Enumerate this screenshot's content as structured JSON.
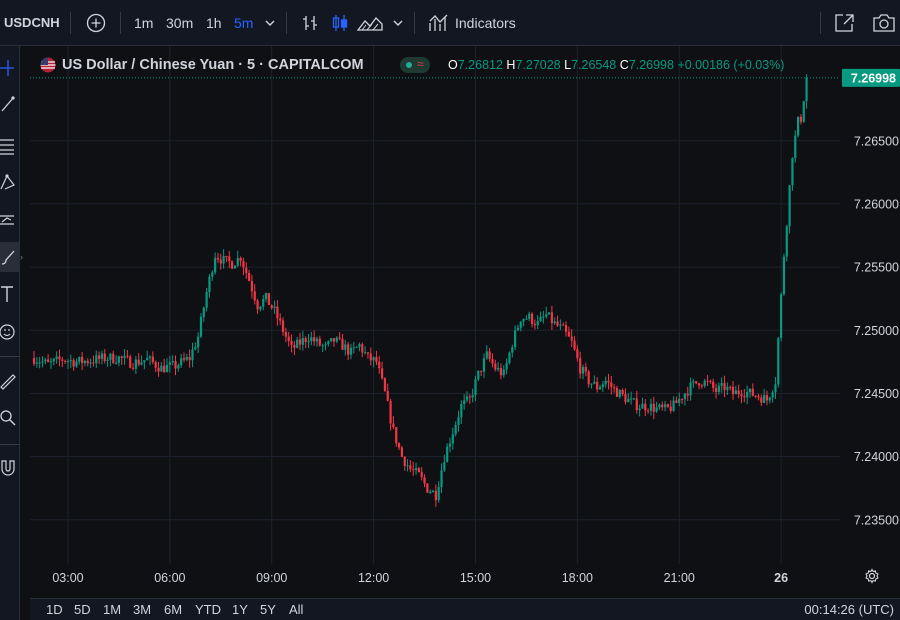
{
  "toolbar": {
    "symbol": "USDCNH",
    "intervals": [
      "1m",
      "30m",
      "1h",
      "5m"
    ],
    "active_interval": "5m",
    "indicators_label": "Indicators"
  },
  "legend": {
    "title": "US Dollar / Chinese Yuan · 5 · CAPITALCOM",
    "o_label": "O",
    "o": "7.26812",
    "h_label": "H",
    "h": "7.27028",
    "l_label": "L",
    "l": "7.26548",
    "c_label": "C",
    "c": "7.26998",
    "change": "+0.00186 (+0.03%)"
  },
  "ranges": [
    "1D",
    "5D",
    "1M",
    "3M",
    "6M",
    "YTD",
    "1Y",
    "5Y",
    "All"
  ],
  "clock": "00:14:26 (UTC)",
  "colors": {
    "up": "#089981",
    "down": "#f23645",
    "price_tag": "#089981",
    "background": "#0f1014",
    "grid": "#1e222d"
  },
  "chart_data": {
    "type": "candlestick",
    "y_ticks": [
      "7.26500",
      "7.26000",
      "7.25500",
      "7.25000",
      "7.24500",
      "7.24000",
      "7.23500"
    ],
    "x_ticks": [
      "03:00",
      "06:00",
      "09:00",
      "12:00",
      "15:00",
      "18:00",
      "21:00",
      "26"
    ],
    "last_price": "7.26998",
    "ylim": [
      7.2315,
      7.2725
    ],
    "grid": true,
    "waypoints": [
      [
        0,
        7.2478
      ],
      [
        5,
        7.2473
      ],
      [
        10,
        7.2477
      ],
      [
        15,
        7.2475
      ],
      [
        20,
        7.2476
      ],
      [
        25,
        7.2478
      ],
      [
        30,
        7.2478
      ],
      [
        35,
        7.2474
      ],
      [
        40,
        7.2477
      ],
      [
        45,
        7.247
      ],
      [
        50,
        7.2472
      ],
      [
        55,
        7.2478
      ],
      [
        58,
        7.2495
      ],
      [
        61,
        7.253
      ],
      [
        64,
        7.256
      ],
      [
        67,
        7.2555
      ],
      [
        70,
        7.2553
      ],
      [
        73,
        7.2558
      ],
      [
        76,
        7.254
      ],
      [
        79,
        7.252
      ],
      [
        82,
        7.2525
      ],
      [
        85,
        7.2515
      ],
      [
        88,
        7.25
      ],
      [
        91,
        7.2485
      ],
      [
        94,
        7.249
      ],
      [
        97,
        7.2495
      ],
      [
        100,
        7.249
      ],
      [
        103,
        7.2486
      ],
      [
        106,
        7.2492
      ],
      [
        109,
        7.2488
      ],
      [
        112,
        7.2482
      ],
      [
        115,
        7.2488
      ],
      [
        118,
        7.2478
      ],
      [
        121,
        7.2475
      ],
      [
        124,
        7.245
      ],
      [
        127,
        7.242
      ],
      [
        130,
        7.24
      ],
      [
        133,
        7.239
      ],
      [
        136,
        7.2385
      ],
      [
        139,
        7.2375
      ],
      [
        142,
        7.237
      ],
      [
        145,
        7.24
      ],
      [
        148,
        7.242
      ],
      [
        151,
        7.244
      ],
      [
        154,
        7.2445
      ],
      [
        157,
        7.2465
      ],
      [
        160,
        7.248
      ],
      [
        163,
        7.247
      ],
      [
        166,
        7.2465
      ],
      [
        169,
        7.249
      ],
      [
        172,
        7.251
      ],
      [
        175,
        7.251
      ],
      [
        178,
        7.2505
      ],
      [
        181,
        7.2512
      ],
      [
        184,
        7.2505
      ],
      [
        187,
        7.25
      ],
      [
        190,
        7.249
      ],
      [
        193,
        7.247
      ],
      [
        196,
        7.246
      ],
      [
        199,
        7.2455
      ],
      [
        202,
        7.246
      ],
      [
        205,
        7.2453
      ],
      [
        208,
        7.2448
      ],
      [
        211,
        7.2443
      ],
      [
        214,
        7.244
      ],
      [
        217,
        7.244
      ],
      [
        220,
        7.2438
      ],
      [
        223,
        7.2437
      ],
      [
        226,
        7.244
      ],
      [
        229,
        7.2448
      ],
      [
        232,
        7.2455
      ],
      [
        235,
        7.246
      ],
      [
        238,
        7.2458
      ],
      [
        241,
        7.2452
      ],
      [
        244,
        7.2455
      ],
      [
        247,
        7.245
      ],
      [
        250,
        7.2452
      ],
      [
        253,
        7.245
      ],
      [
        256,
        7.2448
      ],
      [
        259,
        7.2445
      ],
      [
        262,
        7.246
      ],
      [
        265,
        7.256
      ],
      [
        268,
        7.264
      ],
      [
        270,
        7.2665
      ],
      [
        271,
        7.2668
      ],
      [
        273,
        7.27
      ]
    ]
  }
}
